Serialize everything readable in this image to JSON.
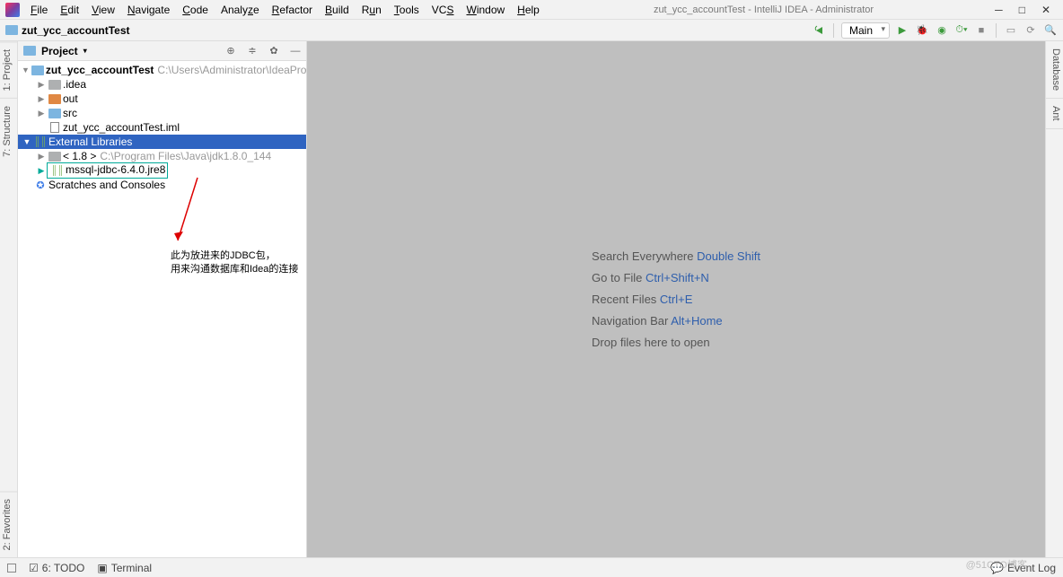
{
  "title": "zut_ycc_accountTest - IntelliJ IDEA - Administrator",
  "menu": [
    "File",
    "Edit",
    "View",
    "Navigate",
    "Code",
    "Analyze",
    "Refactor",
    "Build",
    "Run",
    "Tools",
    "VCS",
    "Window",
    "Help"
  ],
  "breadcrumb": "zut_ycc_accountTest",
  "run_config": "Main",
  "left_tabs": [
    "1: Project",
    "7: Structure",
    "2: Favorites"
  ],
  "right_tabs": [
    "Database",
    "Ant"
  ],
  "panel_title": "Project",
  "tree": {
    "root": {
      "label": "zut_ycc_accountTest",
      "path": "C:\\Users\\Administrator\\IdeaProjects\\zut_ycc"
    },
    "idea": ".idea",
    "out": "out",
    "src": "src",
    "iml": "zut_ycc_accountTest.iml",
    "ext": "External Libraries",
    "jdk": {
      "label": "< 1.8 >",
      "path": "C:\\Program Files\\Java\\jdk1.8.0_144"
    },
    "jdbc": "mssql-jdbc-6.4.0.jre8",
    "scratch": "Scratches and Consoles"
  },
  "annotation": {
    "line1": "此为放进来的JDBC包，",
    "line2": "用来沟通数据库和Idea的连接"
  },
  "welcome": [
    {
      "label": "Search Everywhere ",
      "shortcut": "Double Shift"
    },
    {
      "label": "Go to File ",
      "shortcut": "Ctrl+Shift+N"
    },
    {
      "label": "Recent Files ",
      "shortcut": "Ctrl+E"
    },
    {
      "label": "Navigation Bar ",
      "shortcut": "Alt+Home"
    },
    {
      "label": "Drop files here to open",
      "shortcut": ""
    }
  ],
  "status": {
    "todo": "6: TODO",
    "terminal": "Terminal",
    "event_log": "Event Log"
  },
  "watermark": "@51CTO博客"
}
